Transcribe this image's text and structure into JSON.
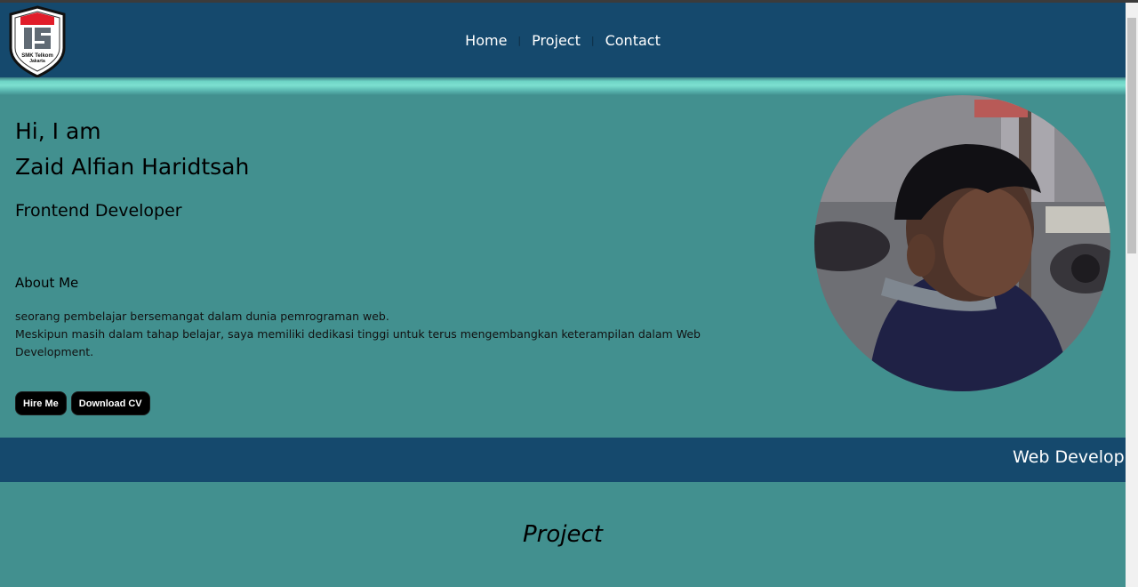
{
  "logo": {
    "text_line1": "SMK Telkom",
    "text_line2": "Jakarta",
    "colors": {
      "red": "#e11d2a",
      "gray": "#606a74",
      "outline": "#111111"
    }
  },
  "nav": {
    "items": [
      "Home",
      "Project",
      "Contact"
    ]
  },
  "hero": {
    "greeting_line1": "Hi, I am",
    "greeting_line2": "Zaid Alfian Haridtsah",
    "role": "Frontend Developer",
    "about_title": "About Me",
    "about_line1": "seorang pembelajar bersemangat dalam dunia pemrograman web.",
    "about_line2": "Meskipun masih dalam tahap belajar, saya memiliki dedikasi tinggi untuk terus mengembangkan keterampilan dalam Web Development.",
    "buttons": {
      "hire": "Hire Me",
      "download": "Download CV"
    }
  },
  "marquee": {
    "text": "Web Develop"
  },
  "project": {
    "title": "Project"
  },
  "colors": {
    "navbar": "#15496d",
    "background": "#42908f",
    "accent": "#7de0d0",
    "button": "#000000"
  }
}
